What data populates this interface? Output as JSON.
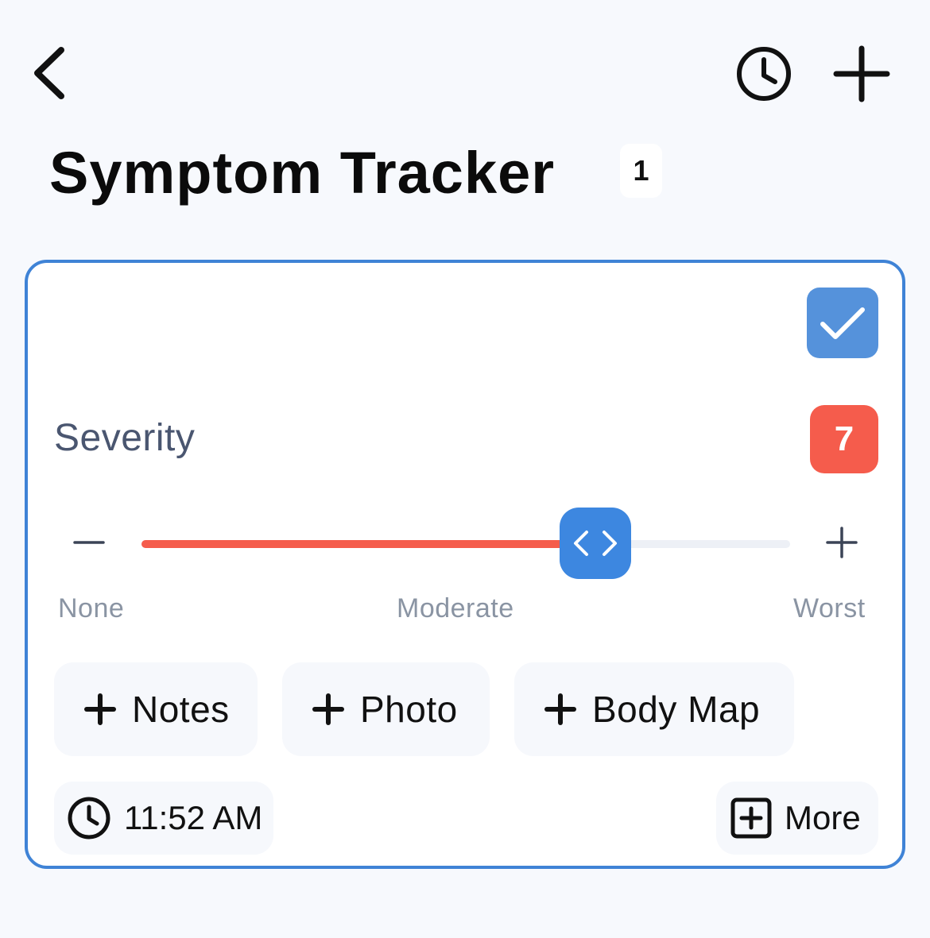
{
  "header": {
    "title": "Symptom Tracker",
    "count": "1",
    "back_icon": "chevron-left-icon",
    "history_icon": "clock-icon",
    "add_icon": "plus-icon"
  },
  "card": {
    "confirm_icon": "check-icon",
    "severity": {
      "label": "Severity",
      "value": "7",
      "min": 0,
      "max": 10,
      "scale_labels": {
        "low": "None",
        "mid": "Moderate",
        "high": "Worst"
      }
    },
    "actions": [
      {
        "label": "Notes"
      },
      {
        "label": "Photo"
      },
      {
        "label": "Body Map"
      }
    ],
    "time": "11:52 AM",
    "more_label": "More"
  },
  "colors": {
    "accent": "#3f83d6",
    "check_bg": "#5592db",
    "severity_red": "#f55c4c",
    "background": "#f7f9fd"
  }
}
